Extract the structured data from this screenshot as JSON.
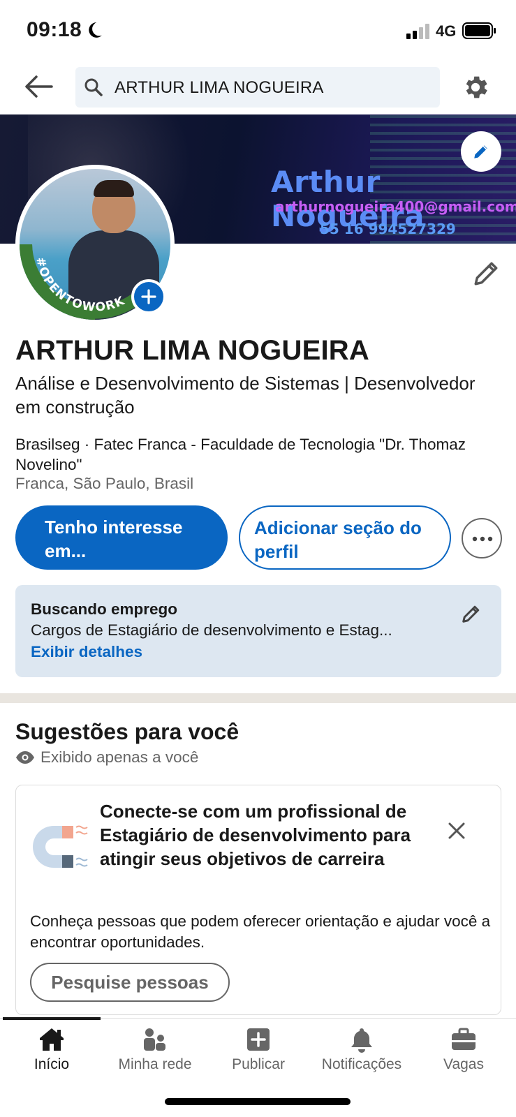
{
  "status_bar": {
    "time": "09:18",
    "network": "4G"
  },
  "search": {
    "query": "ARTHUR LIMA NOGUEIRA"
  },
  "banner": {
    "name": "Arthur Nogueira",
    "email": "arthurnogueira400@gmail.com",
    "phone": "55 16 994527329"
  },
  "avatar": {
    "frame_text": "#OPENTOWORK",
    "frame_color": "#3b7d34"
  },
  "profile": {
    "name": "ARTHUR LIMA NOGUEIRA",
    "headline": "Análise e Desenvolvimento de Sistemas | Desenvolvedor em construção",
    "education": "Brasilseg · Fatec Franca - Faculdade de Tecnologia \"Dr. Thomaz Novelino\"",
    "location": "Franca, São Paulo, Brasil"
  },
  "actions": {
    "primary_label": "Tenho interesse em...",
    "secondary_label": "Adicionar seção do perfil"
  },
  "open_to_work": {
    "title": "Buscando emprego",
    "description": "Cargos de Estagiário de desenvolvimento e Estag...",
    "link": "Exibir detalhes"
  },
  "suggestions": {
    "title": "Sugestões para você",
    "visibility": "Exibido apenas a você",
    "card": {
      "title": "Conecte-se com um profissional de Estagiário de desenvolvimento para atingir seus objetivos de carreira",
      "description": "Conheça pessoas que podem oferecer orientação e ajudar você a encontrar oportunidades.",
      "button": "Pesquise pessoas"
    }
  },
  "nav": {
    "items": [
      {
        "label": "Início",
        "icon": "home-icon",
        "active": true
      },
      {
        "label": "Minha rede",
        "icon": "network-icon",
        "active": false
      },
      {
        "label": "Publicar",
        "icon": "post-icon",
        "active": false
      },
      {
        "label": "Notificações",
        "icon": "bell-icon",
        "active": false
      },
      {
        "label": "Vagas",
        "icon": "briefcase-icon",
        "active": false
      }
    ]
  },
  "colors": {
    "brand_blue": "#0a66c2",
    "card_bg": "#dde7f1",
    "otw_green": "#3b7d34"
  }
}
